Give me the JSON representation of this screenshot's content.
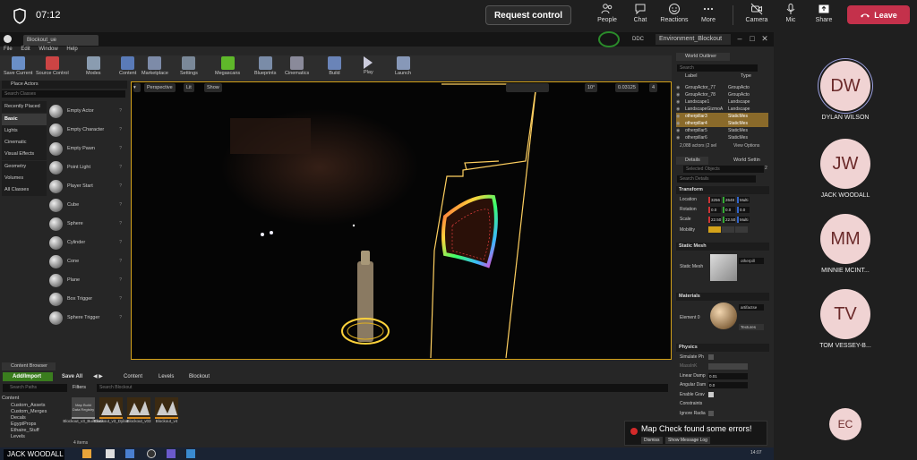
{
  "teams": {
    "timer": "07:12",
    "request_control": "Request control",
    "buttons": [
      {
        "label": "People",
        "icon": "people-icon"
      },
      {
        "label": "Chat",
        "icon": "chat-icon"
      },
      {
        "label": "Reactions",
        "icon": "reactions-icon"
      },
      {
        "label": "More",
        "icon": "more-icon"
      },
      {
        "label": "Camera",
        "icon": "camera-off-icon"
      },
      {
        "label": "Mic",
        "icon": "mic-icon"
      },
      {
        "label": "Share",
        "icon": "share-icon"
      }
    ],
    "leave": "Leave",
    "leave_color": "#c4314b",
    "participants": [
      {
        "initials": "DW",
        "name": "DYLAN WILSON"
      },
      {
        "initials": "JW",
        "name": "JACK WOODALL"
      },
      {
        "initials": "MM",
        "name": "MINNIE MCINT..."
      },
      {
        "initials": "TV",
        "name": "TOM VESSEY-B..."
      }
    ],
    "self_initials": "EC",
    "presenter_name": "JACK WOODALL"
  },
  "ue": {
    "tab": "Blockout_ue",
    "ddc": "DDC",
    "level_tab": "Environment_Blockout",
    "menu": [
      "File",
      "Edit",
      "Window",
      "Help"
    ],
    "toolbar": [
      "Save Current",
      "Source Control",
      "Modes",
      "Content",
      "Marketplace",
      "Settings",
      "Megascans",
      "Blueprints",
      "Cinematics",
      "Build",
      "Play",
      "Launch"
    ],
    "place_actors": {
      "title": "Place Actors",
      "search_placeholder": "Search Classes",
      "categories": [
        "Recently Placed",
        "Basic",
        "Lights",
        "Cinematic",
        "Visual Effects",
        "Geometry",
        "Volumes",
        "All Classes"
      ],
      "selected_category": "Basic",
      "actors": [
        "Empty Actor",
        "Empty Character",
        "Empty Pawn",
        "Point Light",
        "Player Start",
        "Cube",
        "Sphere",
        "Cylinder",
        "Cone",
        "Plane",
        "Box Trigger",
        "Sphere Trigger"
      ]
    },
    "viewport": {
      "perspective": "Perspective",
      "lit": "Lit",
      "show": "Show",
      "angle": "10°",
      "scale": "0.03125",
      "cam_speed": "4"
    },
    "outliner": {
      "title": "World Outliner",
      "search_placeholder": "Search",
      "col_label": "Label",
      "col_type": "Type",
      "rows": [
        {
          "label": "GroupActor_77",
          "type": "GroupActo"
        },
        {
          "label": "GroupActor_78",
          "type": "GroupActo"
        },
        {
          "label": "Landscape1",
          "type": "Landscape"
        },
        {
          "label": "LandscapeGizmoA",
          "type": "Landscape"
        },
        {
          "label": "otherpillar3",
          "type": "StaticMes"
        },
        {
          "label": "otherpillar4",
          "type": "StaticMes"
        },
        {
          "label": "otherpillar5",
          "type": "StaticMes"
        },
        {
          "label": "otherpillar6",
          "type": "StaticMes"
        }
      ],
      "count": "2,088 actors (2 sel",
      "view_options": "View Options"
    },
    "details": {
      "tab1": "Details",
      "tab2": "World Settin",
      "selected": "Selected Objects",
      "selected_count": "2",
      "search_placeholder": "Search Details",
      "transform": "Transform",
      "location": "Location",
      "rotation": "Rotation",
      "scale": "Scale",
      "mobility": "Mobility",
      "loc": [
        "3256",
        "2648",
        "Multi"
      ],
      "rot": [
        "0.0",
        "0.0",
        "0.0"
      ],
      "scl": [
        "22.50",
        "22.50",
        "Multi"
      ],
      "static_mesh_section": "Static Mesh",
      "static_mesh_label": "Static Mesh",
      "mesh_value": "otherpill",
      "materials": "Materials",
      "element0": "Element 0",
      "mat_value": "artifactse",
      "textures": "Textures",
      "physics": "Physics",
      "simulate": "Simulate Ph",
      "mass": "MassInK",
      "linear_damp": "Linear Damp",
      "linear_val": "0.01",
      "angular_damp": "Angular Dam",
      "angular_val": "0.0",
      "enable_grav": "Enable Grav",
      "constraints": "Constraints",
      "ignore_radial": "Ignore Radia"
    },
    "content_browser": {
      "title": "Content Browser",
      "add_import": "Add/Import",
      "save_all": "Save All",
      "crumbs": [
        "Content",
        "Levels",
        "Blockout"
      ],
      "search_paths": "Search Paths",
      "filters": "Filters",
      "search_placeholder": "Search Blockout",
      "tree": [
        "Content",
        "Custom_Assets",
        "Custom_Merges",
        "Decals",
        "EgyptProps",
        "Ethaire_Stuff",
        "Levels"
      ],
      "assets": [
        {
          "name": "Blockout_v3_BuiltData",
          "tile": "Map Build Data Registry"
        },
        {
          "name": "Blockout_v3_Dylan",
          "tile": ""
        },
        {
          "name": "Blockout_v03",
          "tile": ""
        },
        {
          "name": "Blockout_v4",
          "tile": ""
        }
      ],
      "item_count": "4 items"
    },
    "toast": {
      "message": "Map Check found some errors!",
      "dismiss": "Dismiss",
      "show_log": "Show Message Log"
    },
    "clock": "14:07"
  }
}
